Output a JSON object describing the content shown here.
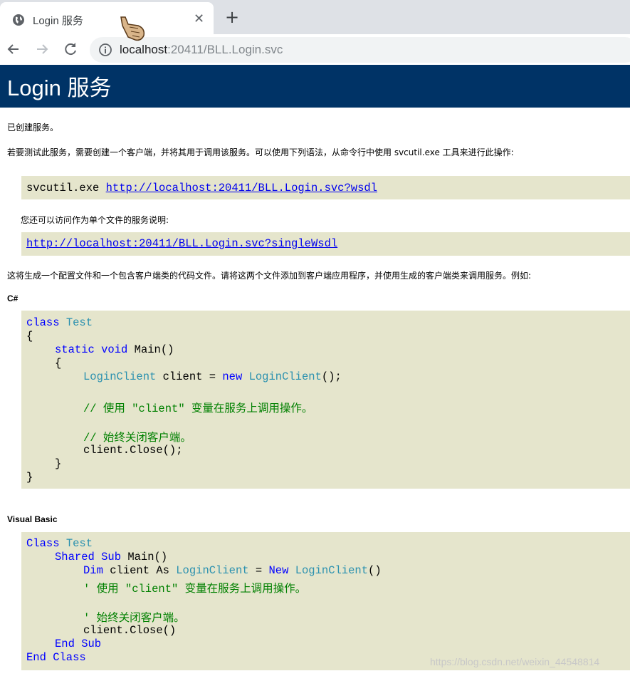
{
  "browser": {
    "tab_title": "Login 服务",
    "tab_close": "✕",
    "new_tab": "+",
    "url_host": "localhost",
    "url_rest": ":20411/BLL.Login.svc"
  },
  "page": {
    "title": "Login 服务",
    "created": "已创建服务。",
    "intro": "若要测试此服务，需要创建一个客户端，并将其用于调用该服务。可以使用下列语法，从命令行中使用 svcutil.exe 工具来进行此操作:",
    "svcutil_cmd": "svcutil.exe ",
    "wsdl_url": "http://localhost:20411/BLL.Login.svc?wsdl",
    "single_file_note": "您还可以访问作为单个文件的服务说明:",
    "single_wsdl_url": "http://localhost:20411/BLL.Login.svc?singleWsdl",
    "generate_note": "这将生成一个配置文件和一个包含客户端类的代码文件。请将这两个文件添加到客户端应用程序，并使用生成的客户端类来调用服务。例如:",
    "csharp_heading": "C#",
    "vb_heading": "Visual Basic"
  },
  "csharp": {
    "class_kw": "class",
    "class_name": "Test",
    "brace_open": "{",
    "brace_close": "}",
    "static_kw": "static",
    "void_kw": "void",
    "main": "Main()",
    "inner_open": "{",
    "inner_close": "}",
    "client_type": "LoginClient",
    "client_decl": " client = ",
    "new_kw": "new",
    "client_ctor": "LoginClient",
    "ctor_end": "();",
    "comment1": "// 使用 \"client\" 变量在服务上调用操作。",
    "comment2": "// 始终关闭客户端。",
    "close_call": "client.Close();"
  },
  "vb": {
    "class_kw": "Class",
    "class_name": "Test",
    "shared_kw": "Shared",
    "sub_kw": "Sub",
    "main": " Main()",
    "dim_kw": "Dim",
    "client_as": " client As ",
    "client_type": "LoginClient",
    "eq": " = ",
    "new_kw": "New",
    "client_ctor": "LoginClient",
    "ctor_end": "()",
    "comment1": "' 使用 \"client\" 变量在服务上调用操作。",
    "comment2": "' 始终关闭客户端。",
    "close_call": "client.Close()",
    "end_sub": "End Sub",
    "end_class": "End Class"
  },
  "watermark": "https://blog.csdn.net/weixin_44548814"
}
